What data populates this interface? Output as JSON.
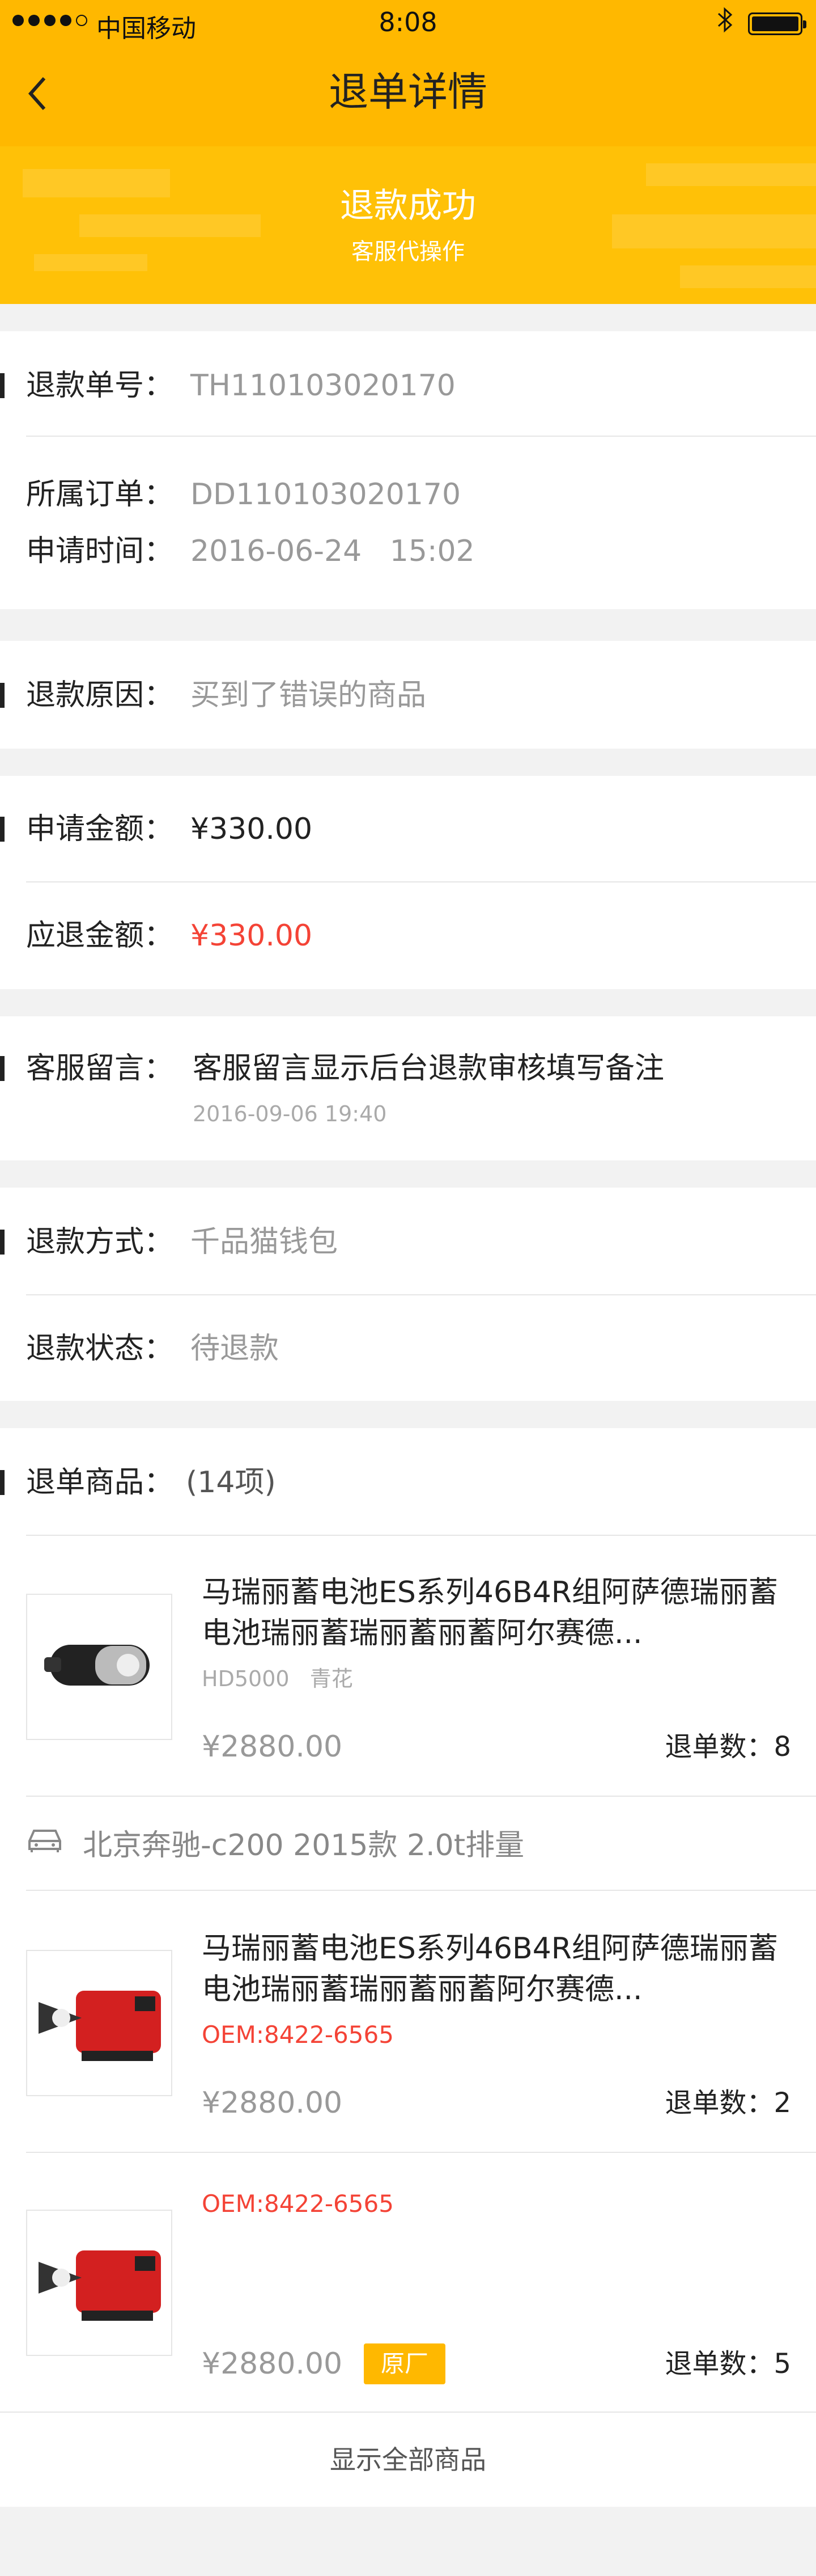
{
  "status_bar": {
    "carrier": "中国移动",
    "time": "8:08"
  },
  "nav": {
    "title": "退单详情"
  },
  "banner": {
    "title": "退款成功",
    "subtitle": "客服代操作"
  },
  "refund_info": {
    "refund_no_label": "退款单号：",
    "refund_no": "TH110103020170",
    "order_label": "所属订单：",
    "order_no": "DD110103020170",
    "apply_time_label": "申请时间：",
    "apply_time": "2016-06-24   15:02"
  },
  "reason": {
    "label": "退款原因：",
    "value": "买到了错误的商品"
  },
  "amounts": {
    "apply_label": "申请金额：",
    "apply_value": "¥330.00",
    "due_label": "应退金额：",
    "due_value": "¥330.00"
  },
  "message": {
    "label": "客服留言：",
    "value": "客服留言显示后台退款审核填写备注",
    "time": "2016-09-06 19:40"
  },
  "method": {
    "method_label": "退款方式：",
    "method_value": "千品猫钱包",
    "status_label": "退款状态：",
    "status_value": "待退款"
  },
  "goods": {
    "label": "退单商品：",
    "count": "(14项)",
    "vehicle": "北京奔驰-c200 2015款 2.0t排量",
    "items": [
      {
        "name": "马瑞丽蓄电池ES系列46B4R组阿萨德瑞丽蓄电池瑞丽蓄瑞丽蓄丽蓄阿尔赛德...",
        "spec": "HD5000   青花",
        "price": "¥2880.00",
        "qty_label": "退单数：8"
      },
      {
        "name": "马瑞丽蓄电池ES系列46B4R组阿萨德瑞丽蓄电池瑞丽蓄瑞丽蓄丽蓄阿尔赛德...",
        "oem": "OEM:8422-6565",
        "price": "¥2880.00",
        "qty_label": "退单数：2"
      },
      {
        "oem": "OEM:8422-6565",
        "price": "¥2880.00",
        "badge": "原厂",
        "qty_label": "退单数：5"
      }
    ],
    "show_all": "显示全部商品"
  },
  "colors": {
    "accent": "#ffb800",
    "red": "#f44336"
  }
}
